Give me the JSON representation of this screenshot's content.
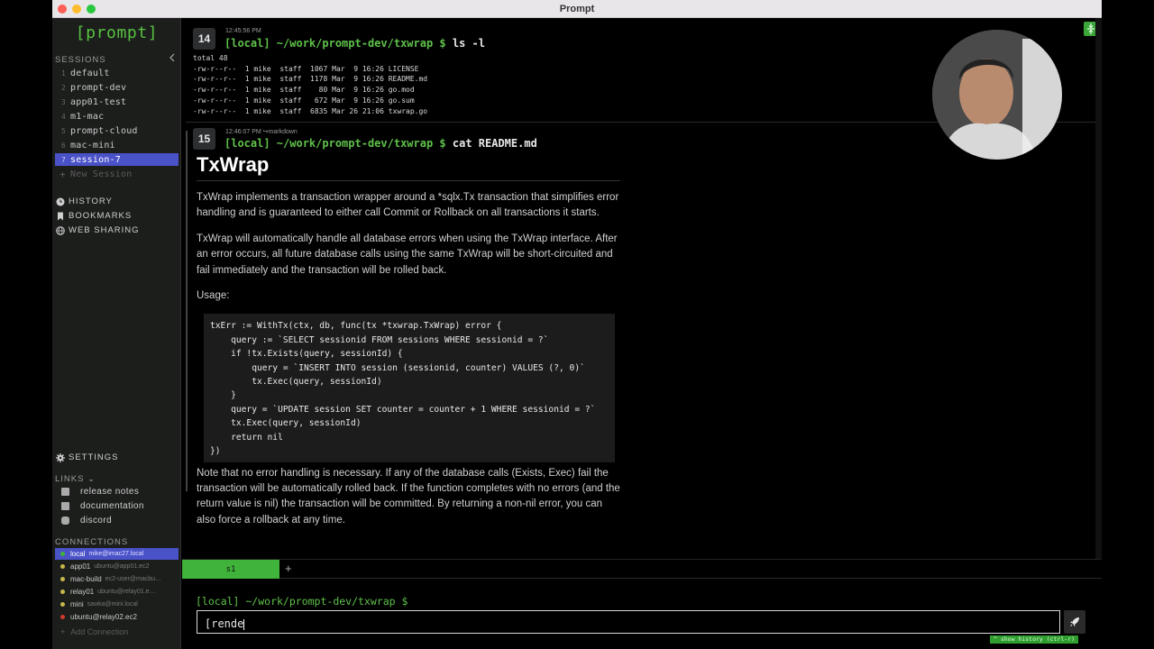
{
  "window": {
    "title": "Prompt"
  },
  "sidebar": {
    "logo": "[prompt]",
    "sessions_header": "SESSIONS",
    "sessions": [
      {
        "num": "1",
        "name": "default"
      },
      {
        "num": "2",
        "name": "prompt-dev"
      },
      {
        "num": "3",
        "name": "app01-test"
      },
      {
        "num": "4",
        "name": "m1-mac"
      },
      {
        "num": "5",
        "name": "prompt-cloud"
      },
      {
        "num": "6",
        "name": "mac-mini"
      },
      {
        "num": "7",
        "name": "session-7",
        "active": true
      }
    ],
    "new_session": "New Session",
    "nav": {
      "history": "HISTORY",
      "bookmarks": "BOOKMARKS",
      "web_sharing": "WEB SHARING",
      "settings": "SETTINGS"
    },
    "links_header": "LINKS",
    "links": [
      "release notes",
      "documentation",
      "discord"
    ],
    "connections_header": "CONNECTIONS",
    "connections": [
      {
        "name": "local",
        "sub": "mike@imac27.local",
        "color": "#3fb33a",
        "active": true
      },
      {
        "name": "app01",
        "sub": "ubuntu@app01.ec2",
        "color": "#c8b84a"
      },
      {
        "name": "mac-build",
        "sub": "ec2-user@macbu…",
        "color": "#c8b84a"
      },
      {
        "name": "relay01",
        "sub": "ubuntu@relay01.e…",
        "color": "#c8b84a"
      },
      {
        "name": "mini",
        "sub": "sawka@mini.local",
        "color": "#c8b84a"
      },
      {
        "name": "ubuntu@relay02.ec2",
        "sub": "",
        "color": "#d33a2a"
      }
    ],
    "add_connection": "Add Connection"
  },
  "commands": [
    {
      "num": "14",
      "time": "12:45:56 PM",
      "prompt_host": "[local]",
      "prompt_path": " ~/work/prompt-dev/txwrap $ ",
      "command": "ls -l",
      "output": [
        "total 48",
        "-rw-r--r--  1 mike  staff  1067 Mar  9 16:26 LICENSE",
        "-rw-r--r--  1 mike  staff  1178 Mar  9 16:26 README.md",
        "-rw-r--r--  1 mike  staff    80 Mar  9 16:26 go.mod",
        "-rw-r--r--  1 mike  staff   672 Mar  9 16:26 go.sum",
        "-rw-r--r--  1 mike  staff  6835 Mar 26 21:06 txwrap.go"
      ]
    },
    {
      "num": "15",
      "time": "12:46:07 PM",
      "renderer": "markdown",
      "prompt_host": "[local]",
      "prompt_path": " ~/work/prompt-dev/txwrap $ ",
      "command": "cat README.md"
    }
  ],
  "markdown": {
    "h1": "TxWrap",
    "p1": "TxWrap implements a transaction wrapper around a *sqlx.Tx transaction that simplifies error handling and is guaranteed to either call Commit or Rollback on all transactions it starts.",
    "p2": "TxWrap will automatically handle all database errors when using the TxWrap interface. After an error occurs, all future database calls using the same TxWrap will be short-circuited and fail immediately and the transaction will be rolled back.",
    "p3": "Usage:",
    "code": "txErr := WithTx(ctx, db, func(tx *txwrap.TxWrap) error {\n    query := `SELECT sessionid FROM sessions WHERE sessionid = ?`\n    if !tx.Exists(query, sessionId) {\n        query = `INSERT INTO session (sessionid, counter) VALUES (?, 0)`\n        tx.Exec(query, sessionId)\n    }\n    query = `UPDATE session SET counter = counter + 1 WHERE sessionid = ?`\n    tx.Exec(query, sessionId)\n    return nil\n})",
    "p4": "Note that no error handling is necessary. If any of the database calls (Exists, Exec) fail the transaction will be automatically rolled back. If the function completes with no errors (and the return value is nil) the transaction will be committed. By returning a non-nil error, you can also force a rollback at any time."
  },
  "tabs": [
    {
      "label": "s1"
    }
  ],
  "tab_add": "+",
  "cmdline": {
    "cwd": "[local] ~/work/prompt-dev/txwrap $",
    "value": "[rende",
    "history_hint": "show history (ctrl-r)"
  },
  "colors": {
    "accent": "#3fb33a",
    "active_session": "#4a52c8"
  }
}
